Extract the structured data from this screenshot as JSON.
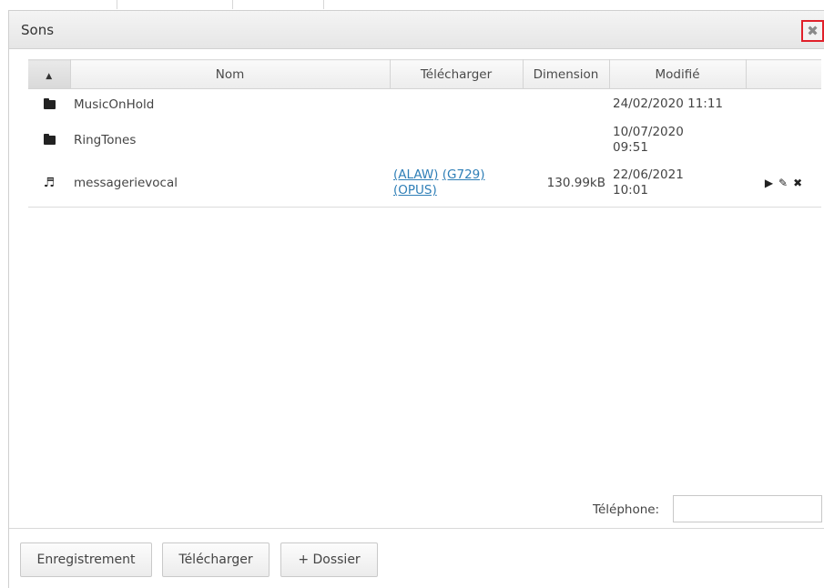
{
  "dialog": {
    "title": "Sons",
    "close_glyph": "✖"
  },
  "table": {
    "sort_arrow": "▲",
    "columns": [
      "Nom",
      "Télécharger",
      "Dimension",
      "Modifié",
      ""
    ],
    "rows": [
      {
        "icon": "folder-icon",
        "name": "MusicOnHold",
        "downloads": [],
        "size": "",
        "modified": [
          "24/02/2020 11:11"
        ]
      },
      {
        "icon": "folder-icon",
        "name": "RingTones",
        "downloads": [],
        "size": "",
        "modified": [
          "10/07/2020",
          "09:51"
        ]
      },
      {
        "icon": "music-note-icon",
        "name": "messagerievocal",
        "downloads": [
          "(ALAW)",
          "(G729)",
          "(OPUS)"
        ],
        "size": "130.99kB",
        "modified": [
          "22/06/2021",
          "10:01"
        ],
        "actions": [
          "▶",
          "✎",
          "✖"
        ]
      }
    ]
  },
  "phone": {
    "label": "Téléphone:",
    "value": ""
  },
  "footer": {
    "buttons": [
      "Enregistrement",
      "Télécharger",
      "+ Dossier"
    ]
  }
}
